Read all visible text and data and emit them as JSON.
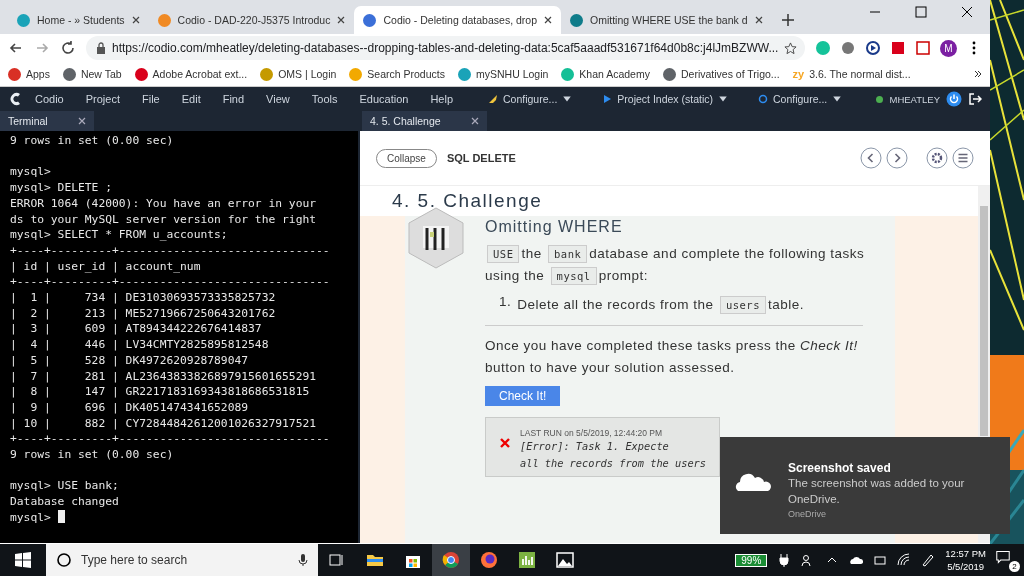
{
  "browser": {
    "tabs": [
      {
        "title": "Home - » Students",
        "selected": false
      },
      {
        "title": "Codio - DAD-220-J5375 Introduc",
        "selected": false
      },
      {
        "title": "Codio - Deleting databases, drop",
        "selected": true
      },
      {
        "title": "Omitting WHERE USE the bank d",
        "selected": false
      }
    ],
    "url": "https://codio.com/mheatley/deleting-databases--dropping-tables-and-deleting-data:5caf5aaadf531671f64d0b8c:j4lJmBZWW...",
    "avatar": "M",
    "bookmarks": [
      {
        "label": "Apps"
      },
      {
        "label": "New Tab"
      },
      {
        "label": "Adobe Acrobat ext..."
      },
      {
        "label": "OMS | Login"
      },
      {
        "label": "Search Products"
      },
      {
        "label": "mySNHU Login"
      },
      {
        "label": "Khan Academy"
      },
      {
        "label": "Derivatives of Trigo..."
      },
      {
        "label": "3.6. The normal dist...",
        "icon_text": "zy"
      }
    ]
  },
  "ide": {
    "menu": [
      "Codio",
      "Project",
      "File",
      "Edit",
      "Find",
      "View",
      "Tools",
      "Education",
      "Help"
    ],
    "tools": [
      "Configure...",
      "Project Index (static)",
      "Configure..."
    ],
    "user": "MHEATLEY",
    "left_tab": "Terminal",
    "right_tab": "4. 5. Challenge"
  },
  "terminal": {
    "output": "9 rows in set (0.00 sec)\n\nmysql>\nmysql> DELETE ;\nERROR 1064 (42000): You have an error in your\nds to your MySQL server version for the right\nmysql> SELECT * FROM u_accounts;\n+----+---------+-------------------------------\n| id | user_id | account_num\n+----+---------+-------------------------------\n|  1 |     734 | DE31030693573335825732\n|  2 |     213 | ME52719667250643201762\n|  3 |     609 | AT894344222676414837\n|  4 |     446 | LV34CMTY2825895812548\n|  5 |     528 | DK4972620928789047\n|  7 |     281 | AL23643833826897915601655291\n|  8 |     147 | GR2217183169343818686531815\n|  9 |     696 | DK4051474341652089\n| 10 |     882 | CY72844842612001026327917521\n+----+---------+-------------------------------\n9 rows in set (0.00 sec)\n\nmysql> USE bank;\nDatabase changed",
    "prompt": "mysql> "
  },
  "guide": {
    "collapse": "Collapse",
    "title": "SQL DELETE",
    "heading": "4. 5. Challenge",
    "card_title": "Omitting WHERE",
    "intro": [
      {
        "kind": "code",
        "text": "USE"
      },
      {
        "kind": "text",
        "text": "the"
      },
      {
        "kind": "code",
        "text": "bank"
      },
      {
        "kind": "text",
        "text": "database and complete the following tasks using the"
      },
      {
        "kind": "code",
        "text": "mysql"
      },
      {
        "kind": "text",
        "text": "prompt:"
      }
    ],
    "task_number": "1.",
    "task": [
      {
        "kind": "text",
        "text": "Delete all the records from the"
      },
      {
        "kind": "code",
        "text": "users"
      },
      {
        "kind": "text",
        "text": "table."
      }
    ],
    "outro": "Once you have completed these tasks press the *Check It!* button to have your solution assessed.",
    "button": "Check It!",
    "last_run": "LAST RUN on 5/5/2019, 12:44:20 PM",
    "error_lines": [
      "[Error]: Task 1. Expecte",
      "all the records from the users"
    ]
  },
  "toast": {
    "title": "Screenshot saved",
    "body": "The screenshot was added to your OneDrive.",
    "source": "OneDrive"
  },
  "taskbar": {
    "search_placeholder": "Type here to search",
    "battery": "99%",
    "time": "12:57 PM",
    "date": "5/5/2019",
    "notifications": "2"
  }
}
